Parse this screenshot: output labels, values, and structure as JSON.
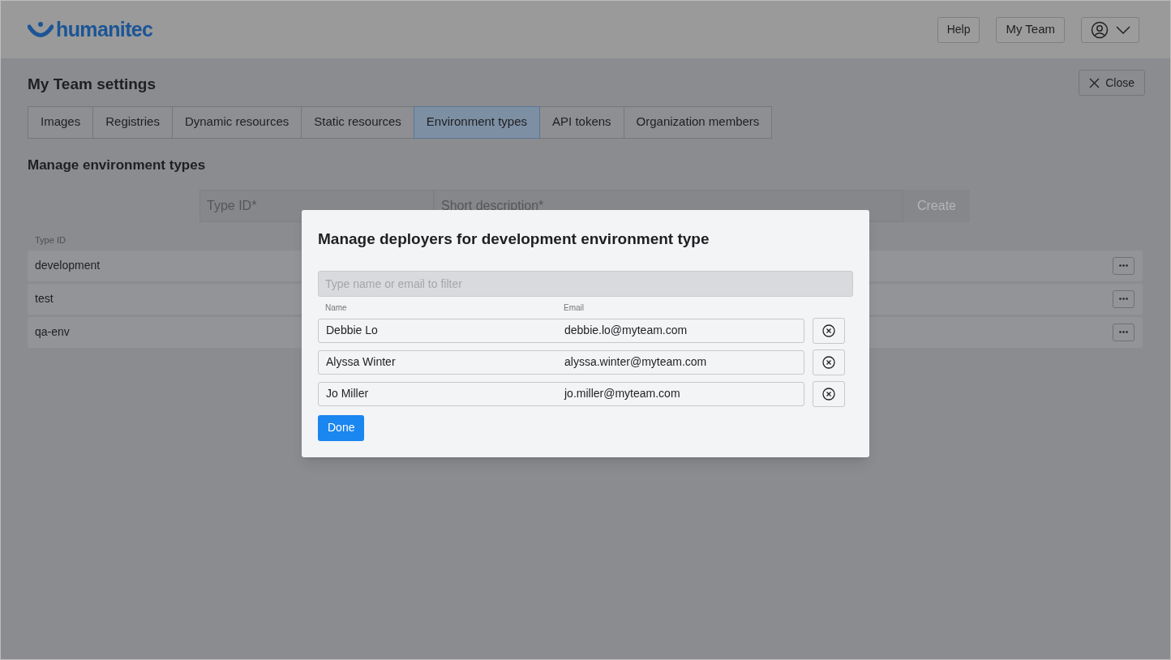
{
  "header": {
    "logo": "humanitec",
    "buttons": [
      "Help",
      "My Team"
    ]
  },
  "page": {
    "title": "My Team settings",
    "close": "Close",
    "tabs": [
      {
        "label": "Images",
        "selected": false
      },
      {
        "label": "Registries",
        "selected": false
      },
      {
        "label": "Dynamic resources",
        "selected": false
      },
      {
        "label": "Static resources",
        "selected": false
      },
      {
        "label": "Environment types",
        "selected": true
      },
      {
        "label": "API tokens",
        "selected": false
      },
      {
        "label": "Organization members",
        "selected": false
      }
    ],
    "section_title": "Manage environment types",
    "form": {
      "type_id_placeholder": "Type ID*",
      "description_placeholder": "Short description*",
      "create": "Create"
    },
    "table": {
      "columns": [
        "Type ID"
      ],
      "rows": [
        {
          "type_id": "development"
        },
        {
          "type_id": "test"
        },
        {
          "type_id": "qa-env"
        }
      ]
    }
  },
  "dialog": {
    "title": "Manage deployers for development environment type",
    "filter_placeholder": "Type name or email to filter",
    "columns": [
      "Name",
      "Email"
    ],
    "deployers": [
      {
        "name": "Debbie Lo",
        "email": "debbie.lo@myteam.com"
      },
      {
        "name": "Alyssa Winter",
        "email": "alyssa.winter@myteam.com"
      },
      {
        "name": "Jo Miller",
        "email": "jo.miller@myteam.com"
      }
    ],
    "done": "Done"
  }
}
